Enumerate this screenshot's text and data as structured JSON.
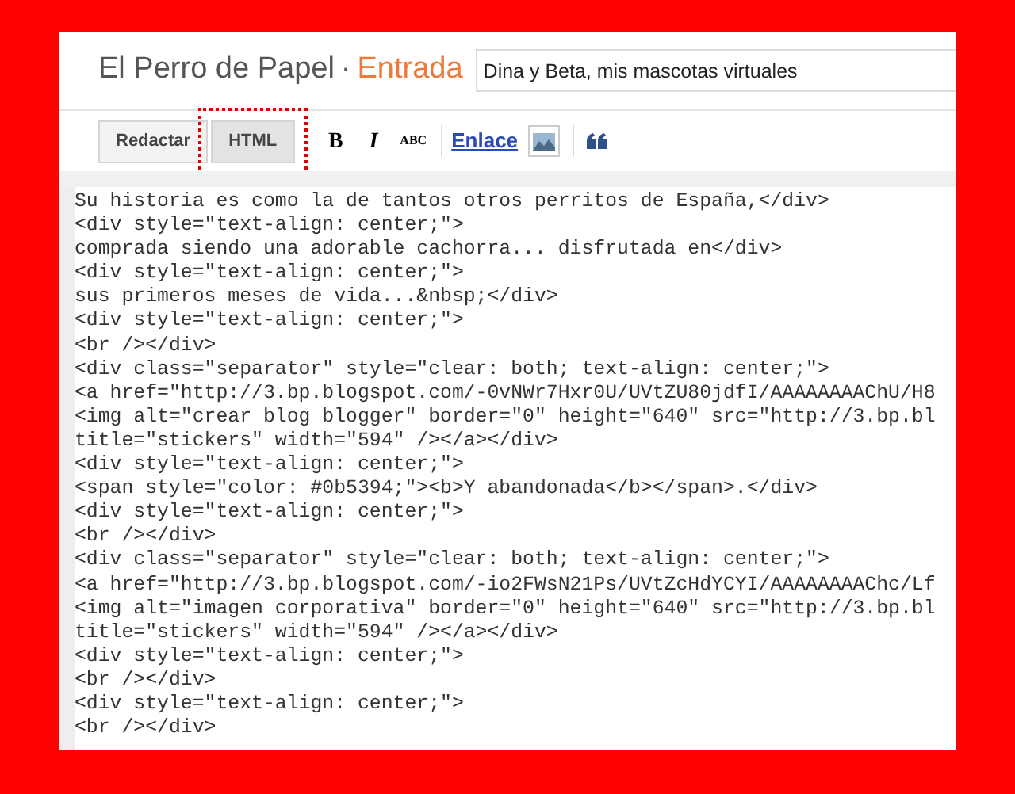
{
  "header": {
    "blog_title": "El Perro de Papel",
    "separator": "·",
    "section": "Entrada",
    "post_title": "Dina y Beta, mis mascotas virtuales"
  },
  "modes": [
    {
      "label": "Redactar",
      "selected": false,
      "annotated": false
    },
    {
      "label": "HTML",
      "selected": true,
      "annotated": true
    }
  ],
  "toolbar": [
    {
      "kind": "bold",
      "label": "B"
    },
    {
      "kind": "italic",
      "label": "I"
    },
    {
      "kind": "strike",
      "label": "ABC"
    },
    {
      "kind": "divider"
    },
    {
      "kind": "link",
      "label": "Enlace"
    },
    {
      "kind": "image"
    },
    {
      "kind": "divider"
    },
    {
      "kind": "quote"
    }
  ],
  "code_lines": [
    "Su historia es como la de tantos otros perritos de España,</div>",
    "<div style=\"text-align: center;\">",
    "comprada siendo una adorable cachorra... disfrutada en</div>",
    "<div style=\"text-align: center;\">",
    "sus primeros meses de vida...&nbsp;</div>",
    "<div style=\"text-align: center;\">",
    "<br /></div>",
    "<div class=\"separator\" style=\"clear: both; text-align: center;\">",
    "<a href=\"http://3.bp.blogspot.com/-0vNWr7Hxr0U/UVtZU80jdfI/AAAAAAAAChU/H8",
    "<img alt=\"crear blog blogger\" border=\"0\" height=\"640\" src=\"http://3.bp.bl",
    "title=\"stickers\" width=\"594\" /></a></div>",
    "<div style=\"text-align: center;\">",
    "<span style=\"color: #0b5394;\"><b>Y abandonada</b></span>.</div>",
    "<div style=\"text-align: center;\">",
    "<br /></div>",
    "<div class=\"separator\" style=\"clear: both; text-align: center;\">",
    "<a href=\"http://3.bp.blogspot.com/-io2FWsN21Ps/UVtZcHdYCYI/AAAAAAAAChc/Lf",
    "<img alt=\"imagen corporativa\" border=\"0\" height=\"640\" src=\"http://3.bp.bl",
    "title=\"stickers\" width=\"594\" /></a></div>",
    "<div style=\"text-align: center;\">",
    "<br /></div>",
    "<div style=\"text-align: center;\">",
    "<br /></div>"
  ]
}
